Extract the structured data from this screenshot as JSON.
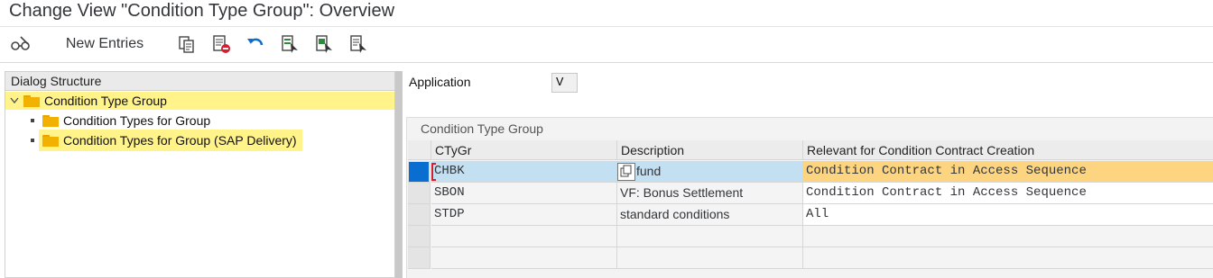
{
  "window": {
    "title": "Change View \"Condition Type Group\": Overview"
  },
  "toolbar": {
    "display_change_icon": "glasses-icon",
    "new_entries_label": "New Entries",
    "icons": [
      "copy-icon",
      "delete-icon",
      "undo-icon",
      "select-all-icon",
      "select-block-icon",
      "deselect-all-icon"
    ]
  },
  "dialog": {
    "header": "Dialog Structure",
    "items": [
      {
        "label": "Condition Type Group",
        "highlight": true
      },
      {
        "label": "Condition Types for Group",
        "highlight": false
      },
      {
        "label": "Condition Types for Group (SAP Delivery)",
        "highlight": true
      }
    ]
  },
  "application": {
    "label": "Application",
    "value": "V"
  },
  "table": {
    "title": "Condition Type Group",
    "columns": [
      "CTyGr",
      "Description",
      "Relevant for Condition Contract Creation"
    ],
    "rows": [
      {
        "ctygr": "CHBK",
        "description": "fund",
        "relevant": "Condition Contract in Access Sequence",
        "selected": true
      },
      {
        "ctygr": "SBON",
        "description": "VF: Bonus Settlement",
        "relevant": "Condition Contract in Access Sequence",
        "selected": false
      },
      {
        "ctygr": "STDP",
        "description": "standard conditions",
        "relevant": "All",
        "selected": false
      }
    ]
  },
  "colors": {
    "tree_highlight": "#fff38a",
    "row_selected": "#c3e0f2",
    "row_selected_handle": "#0a6ed1",
    "relevant_selected": "#fdd580",
    "accent_blue": "#0a6ed1"
  }
}
